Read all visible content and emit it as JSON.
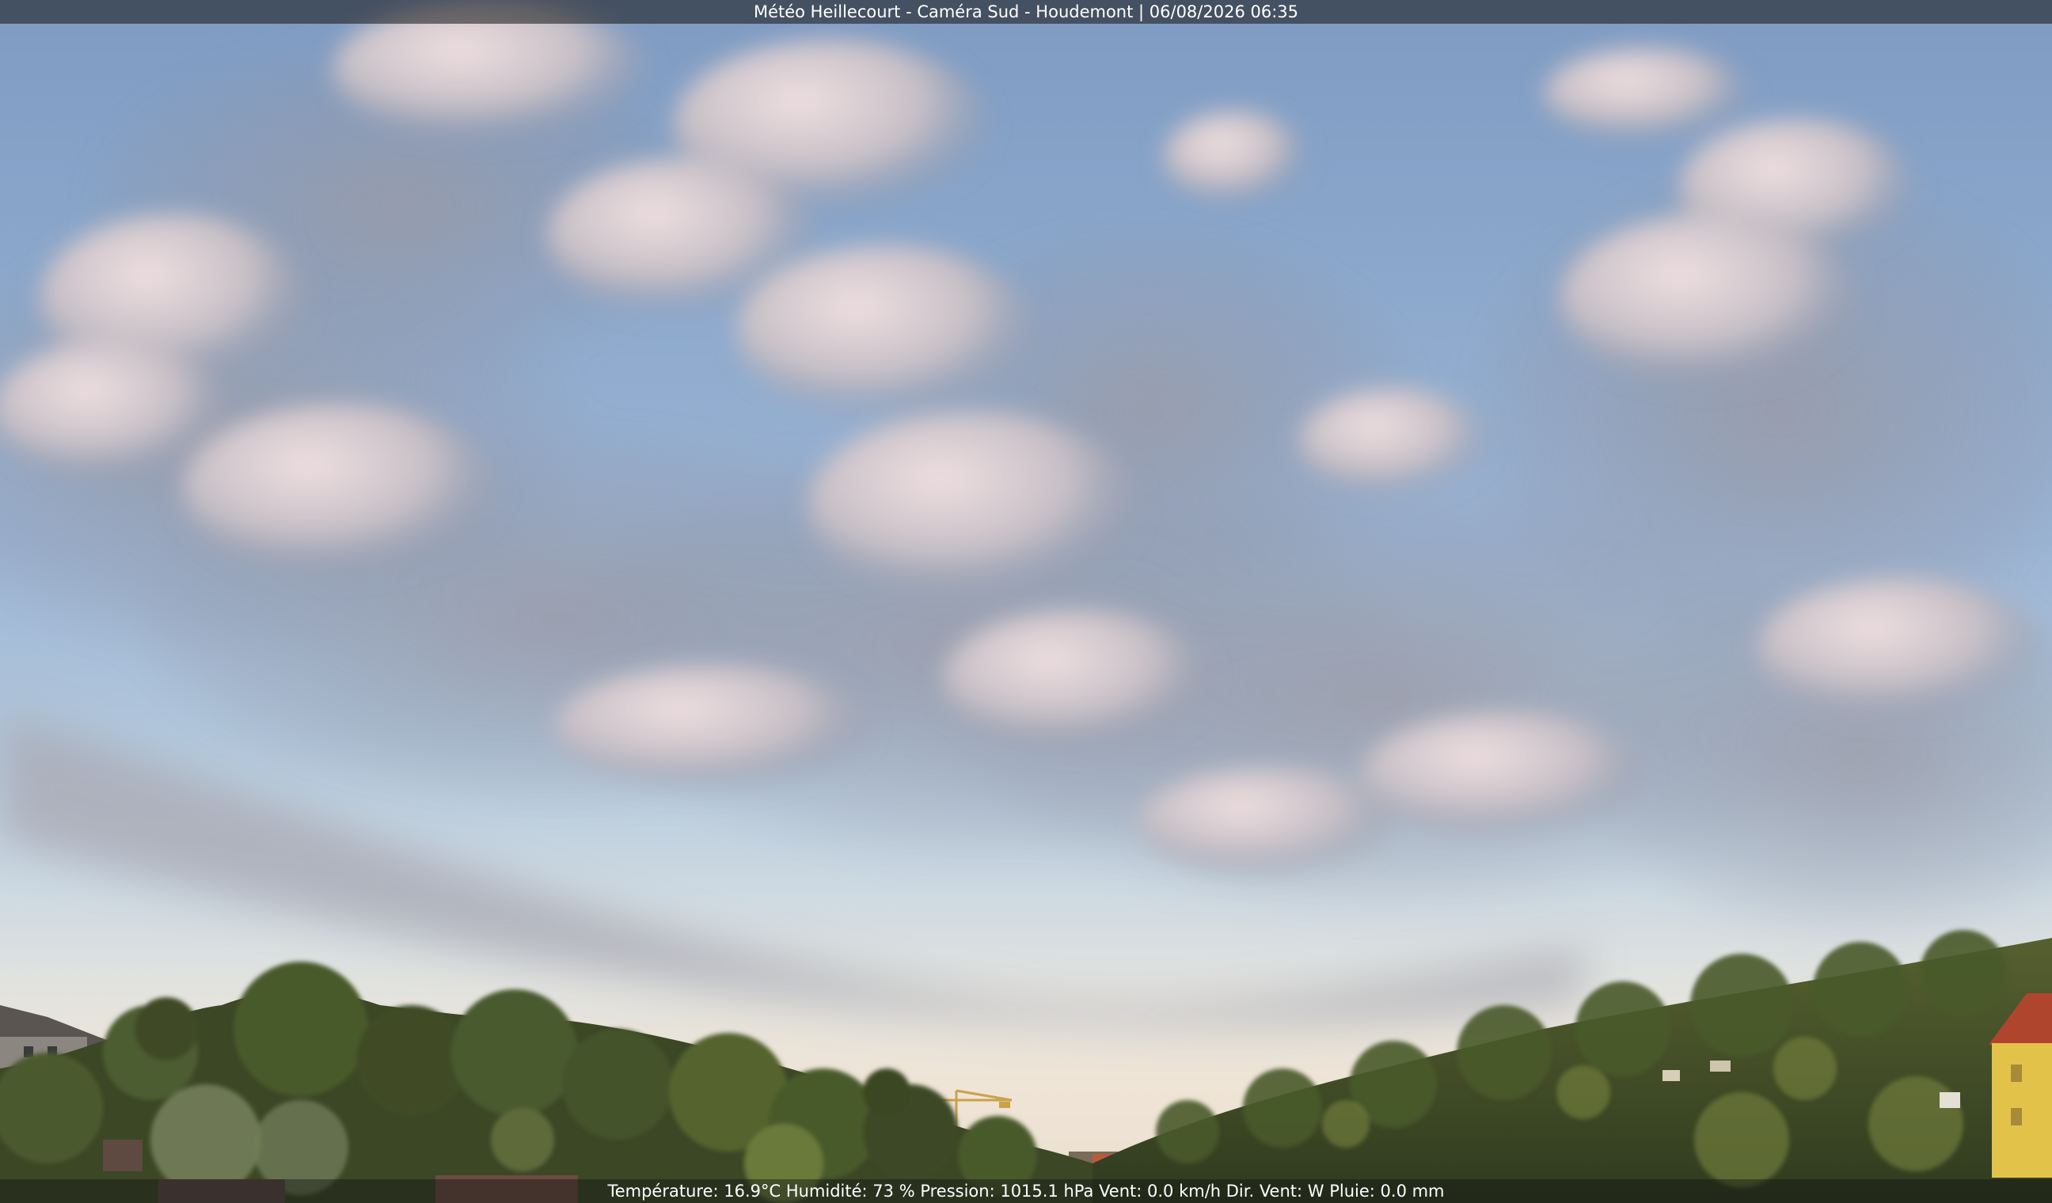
{
  "camera": {
    "title": "Météo Heillecourt - Caméra Sud - Houdemont | 06/08/2026 06:35"
  },
  "weather": {
    "readout": "Température: 16.9°C  Humidité: 73 % Pression: 1015.1 hPa Vent: 0.0 km/h Dir. Vent: W Pluie: 0.0 mm"
  },
  "colors": {
    "sky_top": "#7f9bc2",
    "sky_horizon": "#efe4d6",
    "cloud_light": "#ecdde0",
    "cloud_shadow": "#8e95a6",
    "trees": "#3f4b28"
  }
}
